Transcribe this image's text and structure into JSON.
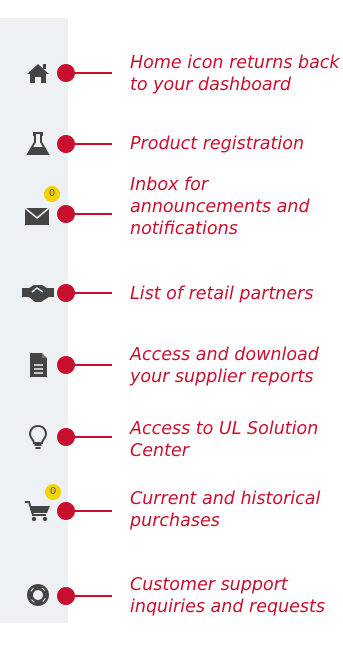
{
  "sidebar": {
    "items": [
      {
        "icon": "home-icon",
        "label": "Home icon returns back to your dashboard"
      },
      {
        "icon": "flask-icon",
        "label": "Product registration"
      },
      {
        "icon": "envelope-icon",
        "label": "Inbox for announcements and notifications",
        "badge": "0"
      },
      {
        "icon": "handshake-icon",
        "label": "List of retail partners"
      },
      {
        "icon": "document-icon",
        "label": "Access and download your supplier reports"
      },
      {
        "icon": "lightbulb-icon",
        "label": "Access to UL Solution Center"
      },
      {
        "icon": "cart-icon",
        "label": "Current and historical purchases",
        "badge": "0"
      },
      {
        "icon": "lifebuoy-icon",
        "label": "Customer support inquiries and requests"
      }
    ]
  },
  "colors": {
    "accent": "#c8102e",
    "rail": "#eef1f4",
    "icon": "#444444",
    "badge": "#f5d200"
  }
}
